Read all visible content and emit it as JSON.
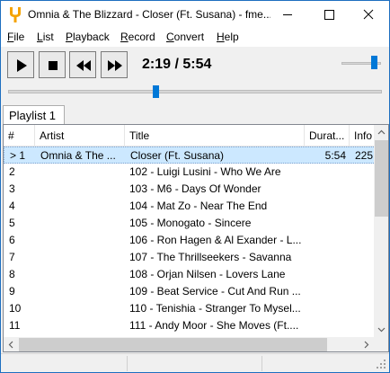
{
  "window": {
    "title": "Omnia & The Blizzard - Closer (Ft. Susana) - fme...",
    "accent_color": "#1e6fc0",
    "icon": "tuning-fork-icon"
  },
  "menu": [
    "File",
    "List",
    "Playback",
    "Record",
    "Convert",
    "Help"
  ],
  "player": {
    "time": "2:19 / 5:54",
    "controls": [
      "play-icon",
      "stop-icon",
      "rewind-icon",
      "fast-forward-icon"
    ],
    "volume_fraction": 0.85,
    "seek_fraction": 0.4
  },
  "tabs": [
    "Playlist 1"
  ],
  "playlist": {
    "columns": [
      "#",
      "Artist",
      "Title",
      "Durat...",
      "Info"
    ],
    "rows": [
      {
        "num": "> 1",
        "artist": "Omnia & The ...",
        "title": "Closer (Ft. Susana)",
        "duration": "5:54",
        "info": "225",
        "selected": true
      },
      {
        "num": "2",
        "artist": "",
        "title": "102 - Luigi Lusini - Who We Are",
        "duration": "",
        "info": ""
      },
      {
        "num": "3",
        "artist": "",
        "title": "103 - M6 - Days Of Wonder",
        "duration": "",
        "info": ""
      },
      {
        "num": "4",
        "artist": "",
        "title": "104 - Mat Zo - Near The End",
        "duration": "",
        "info": ""
      },
      {
        "num": "5",
        "artist": "",
        "title": "105 - Monogato - Sincere",
        "duration": "",
        "info": ""
      },
      {
        "num": "6",
        "artist": "",
        "title": "106 - Ron Hagen & Al Exander - L...",
        "duration": "",
        "info": ""
      },
      {
        "num": "7",
        "artist": "",
        "title": "107 - The Thrillseekers - Savanna",
        "duration": "",
        "info": ""
      },
      {
        "num": "8",
        "artist": "",
        "title": "108 - Orjan Nilsen - Lovers Lane",
        "duration": "",
        "info": ""
      },
      {
        "num": "9",
        "artist": "",
        "title": "109 - Beat Service - Cut And Run ...",
        "duration": "",
        "info": ""
      },
      {
        "num": "10",
        "artist": "",
        "title": "110 - Tenishia - Stranger To Mysel...",
        "duration": "",
        "info": ""
      },
      {
        "num": "11",
        "artist": "",
        "title": "111 - Andy Moor - She Moves (Ft....",
        "duration": "",
        "info": ""
      }
    ]
  }
}
